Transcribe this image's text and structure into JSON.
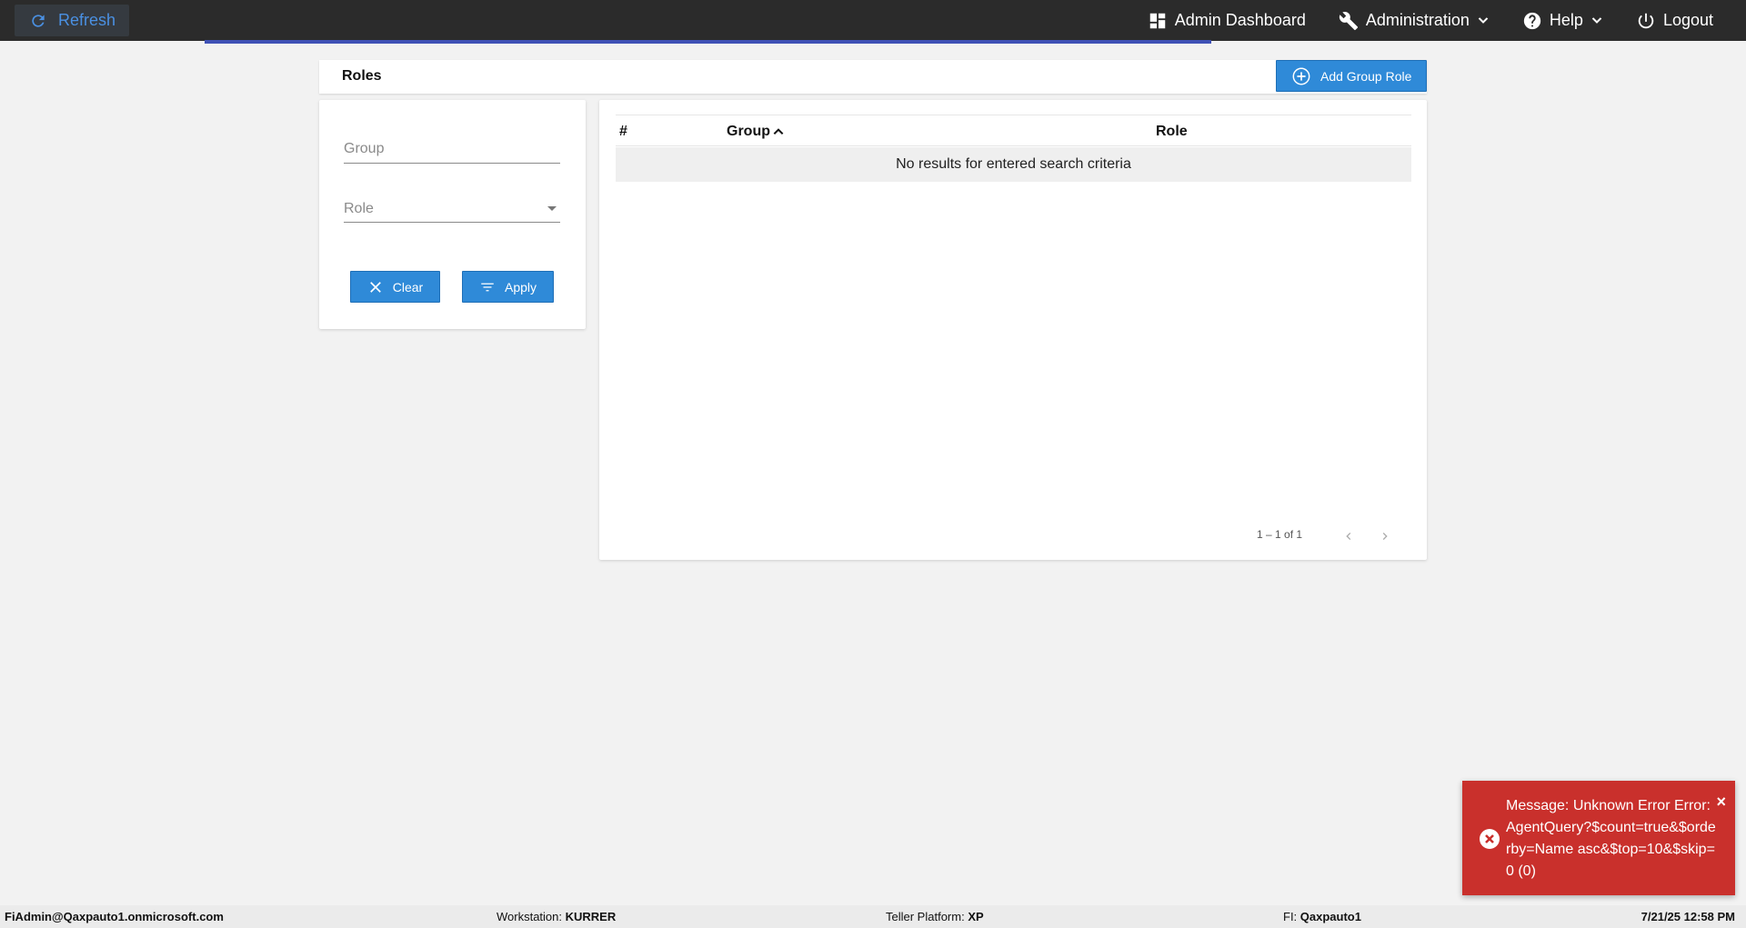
{
  "topbar": {
    "refresh_label": "Refresh",
    "nav": {
      "admin_dashboard": "Admin Dashboard",
      "administration": "Administration",
      "help": "Help",
      "logout": "Logout"
    }
  },
  "page": {
    "title": "Roles",
    "add_button_label": "Add Group Role"
  },
  "filters": {
    "group_placeholder": "Group",
    "role_placeholder": "Role",
    "clear_label": "Clear",
    "apply_label": "Apply"
  },
  "table": {
    "columns": [
      "#",
      "Group",
      "Role"
    ],
    "empty_message": "No results for entered search criteria",
    "pagination": "1 – 1 of 1"
  },
  "toast": {
    "message": "Message: Unknown Error Error: AgentQuery?$count=true&$orderby=Name asc&$top=10&$skip=0 (0)",
    "close": "×"
  },
  "statusbar": {
    "user": "FiAdmin@Qaxpauto1.onmicrosoft.com",
    "workstation_label": "Workstation: ",
    "workstation_value": "KURRER",
    "platform_label": "Teller Platform: ",
    "platform_value": "XP",
    "fi_label": "FI: ",
    "fi_value": "Qaxpauto1",
    "datetime": "7/21/25 12:58 PM"
  },
  "colors": {
    "topbar": "#2b2b2b",
    "accent": "#2f8ad8",
    "progress": "#3f51b5",
    "error": "#c9302c"
  }
}
